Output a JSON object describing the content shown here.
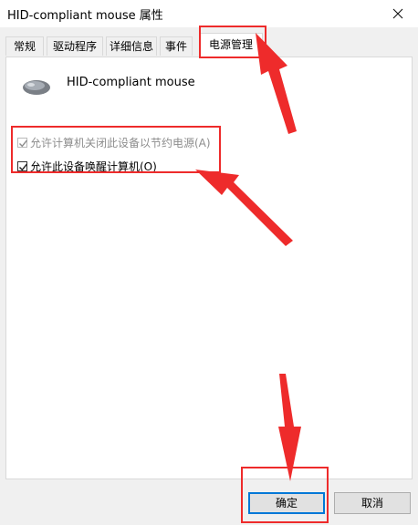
{
  "window": {
    "title": "HID-compliant mouse 属性",
    "close_glyph": "✕"
  },
  "tabs": [
    {
      "label": "常规"
    },
    {
      "label": "驱动程序"
    },
    {
      "label": "详细信息"
    },
    {
      "label": "事件"
    },
    {
      "label": "电源管理",
      "active": true
    }
  ],
  "device": {
    "name": "HID-compliant mouse",
    "icon": "mouse-icon"
  },
  "options": [
    {
      "label": "允许计算机关闭此设备以节约电源(A)",
      "checked": true,
      "disabled": true
    },
    {
      "label": "允许此设备唤醒计算机(O)",
      "checked": true,
      "disabled": false
    }
  ],
  "buttons": {
    "ok": "确定",
    "cancel": "取消"
  },
  "colors": {
    "annotation": "#ee2b2b",
    "accent": "#0078d7"
  }
}
